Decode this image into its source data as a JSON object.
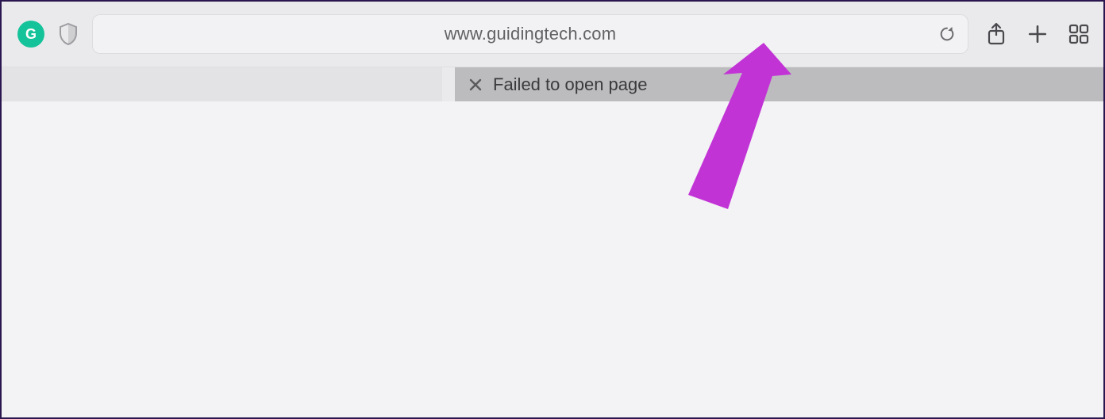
{
  "toolbar": {
    "extension_letter": "G",
    "url": "www.guidingtech.com"
  },
  "tab": {
    "title": "Failed to open page"
  },
  "annotation": {
    "arrow_color": "#c233d6"
  }
}
